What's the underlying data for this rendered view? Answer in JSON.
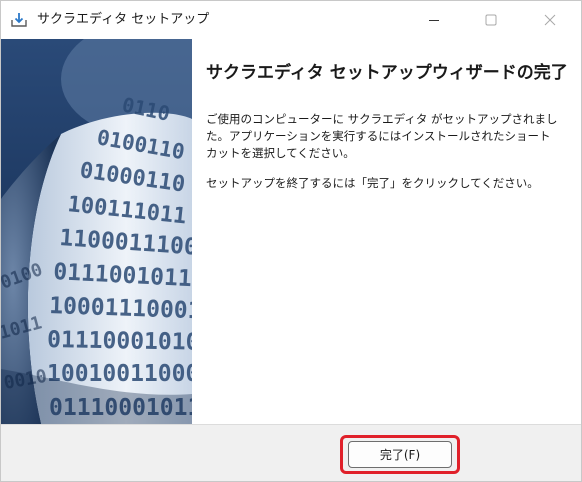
{
  "window": {
    "title": "サクラエディタ セットアップ",
    "controls": {
      "minimize": "minimize-icon",
      "maximize": "maximize-icon",
      "close": "close-icon"
    }
  },
  "content": {
    "heading": "サクラエディタ セットアップウィザードの完了",
    "paragraph1": [
      "ご使用のコンピューターに サクラエディタ がセットアップされまし",
      "た。アプリケーションを実行するにはインストールされたショート",
      "カットを選択してください。"
    ],
    "paragraph2": "セットアップを終了するには「完了」をクリックしてください。"
  },
  "buttons": {
    "finish": "完了(F)"
  },
  "colors": {
    "highlight": "#e0202a",
    "banner_dark": "#1e3a66",
    "banner_light": "#dce6f2"
  }
}
